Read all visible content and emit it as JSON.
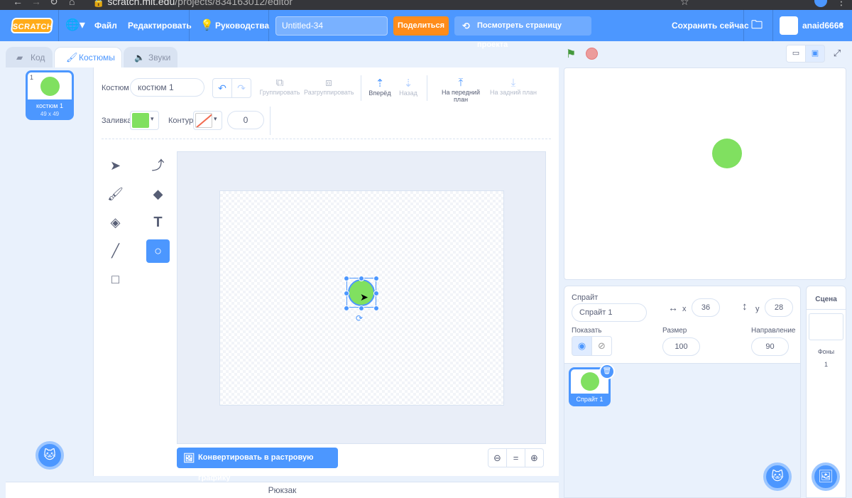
{
  "browser": {
    "url_host": "scratch.mit.edu",
    "url_path": "/projects/834163012/editor"
  },
  "menubar": {
    "logo": "SCRATCH",
    "file": "Файл",
    "edit": "Редактировать",
    "tutorials": "Руководства",
    "project_title": "Untitled-34",
    "share": "Поделиться",
    "see_project_page": "Посмотреть страницу проекта",
    "save_now": "Сохранить сейчас",
    "username": "anaid6666"
  },
  "tabs": [
    {
      "label": "Код"
    },
    {
      "label": "Костюмы"
    },
    {
      "label": "Звуки"
    }
  ],
  "costume_list": [
    {
      "index": "1",
      "name": "костюм 1",
      "size": "49 x 49"
    }
  ],
  "paint_editor": {
    "costume_label": "Костюм",
    "costume_name": "костюм 1",
    "group": "Группировать",
    "ungroup": "Разгруппировать",
    "forward": "Вперёд",
    "backward": "Назад",
    "front": "На передний план",
    "back": "На задний план",
    "fill_label": "Заливка",
    "fill_color": "#80e060",
    "outline_label": "Контур",
    "outline_width": "0",
    "convert_button": "Конвертировать в растровую графику"
  },
  "stage": {
    "sprite_color": "#80e060"
  },
  "sprite_info": {
    "sprite_label": "Спрайт",
    "sprite_name": "Спрайт 1",
    "x_label": "x",
    "x": "36",
    "y_label": "y",
    "y": "28",
    "show_label": "Показать",
    "size_label": "Размер",
    "size": "100",
    "direction_label": "Направление",
    "direction": "90"
  },
  "sprites": [
    {
      "name": "Спрайт 1"
    }
  ],
  "scene": {
    "title": "Сцена",
    "backdrops_label": "Фоны",
    "backdrops_count": "1"
  },
  "backpack": {
    "label": "Рюкзак"
  },
  "colors": {
    "accent": "#4c97ff",
    "share": "#ff8c1a",
    "sprite": "#80e060"
  }
}
